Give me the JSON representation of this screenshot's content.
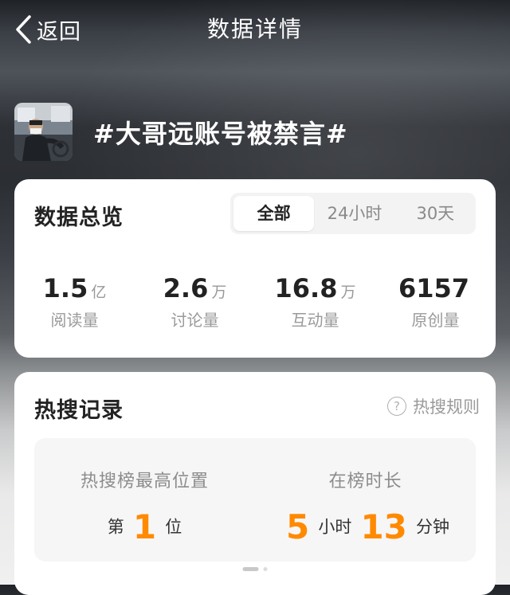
{
  "nav": {
    "back_label": "返回",
    "title": "数据详情"
  },
  "topic": {
    "title": "#大哥远账号被禁言#"
  },
  "overview": {
    "heading": "数据总览",
    "tabs": [
      {
        "label": "全部",
        "active": true
      },
      {
        "label": "24小时",
        "active": false
      },
      {
        "label": "30天",
        "active": false
      }
    ],
    "stats": [
      {
        "value": "1.5",
        "unit": "亿",
        "label": "阅读量"
      },
      {
        "value": "2.6",
        "unit": "万",
        "label": "讨论量"
      },
      {
        "value": "16.8",
        "unit": "万",
        "label": "互动量"
      },
      {
        "value": "6157",
        "unit": "",
        "label": "原创量"
      }
    ]
  },
  "hot_record": {
    "heading": "热搜记录",
    "rules_label": "热搜规则",
    "best_position": {
      "label": "热搜榜最高位置",
      "prefix": "第",
      "value": "1",
      "suffix": "位"
    },
    "duration": {
      "label": "在榜时长",
      "hours": "5",
      "hours_unit": "小时",
      "minutes": "13",
      "minutes_unit": "分钟"
    }
  },
  "colors": {
    "accent": "#ff8a00",
    "card_bg": "#ffffff",
    "text_primary": "#222222",
    "text_secondary": "#9a9a9a"
  },
  "icons": {
    "back": "chevron-left-icon",
    "help": "question-circle-icon"
  },
  "pager": {
    "count": 2,
    "active_index": 0
  }
}
